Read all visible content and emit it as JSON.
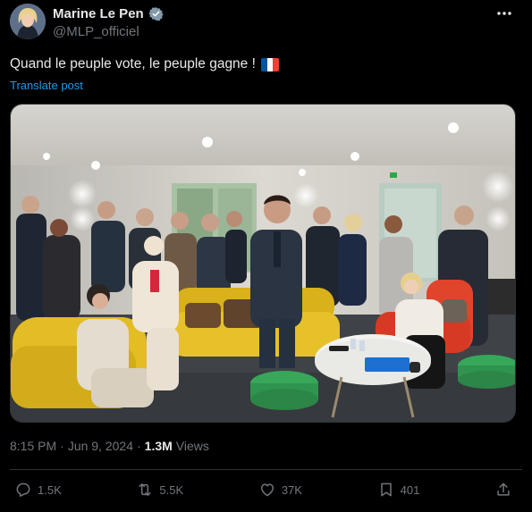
{
  "author": {
    "display_name": "Marine Le Pen",
    "handle": "@MLP_officiel"
  },
  "tweet": {
    "text": "Quand le peuple vote, le peuple gagne !",
    "flag_colors": [
      "#0055a4",
      "#ffffff",
      "#ef4135"
    ],
    "translate_label": "Translate post"
  },
  "meta": {
    "time": "8:15 PM",
    "date": "Jun 9, 2024",
    "views_count": "1.3M",
    "views_label": "Views"
  },
  "actions": {
    "replies": "1.5K",
    "reposts": "5.5K",
    "likes": "37K",
    "bookmarks": "401"
  },
  "colors": {
    "accent": "#1d9bf0",
    "text": "#e7e9ea",
    "muted": "#71767b",
    "border": "#2f3336"
  }
}
